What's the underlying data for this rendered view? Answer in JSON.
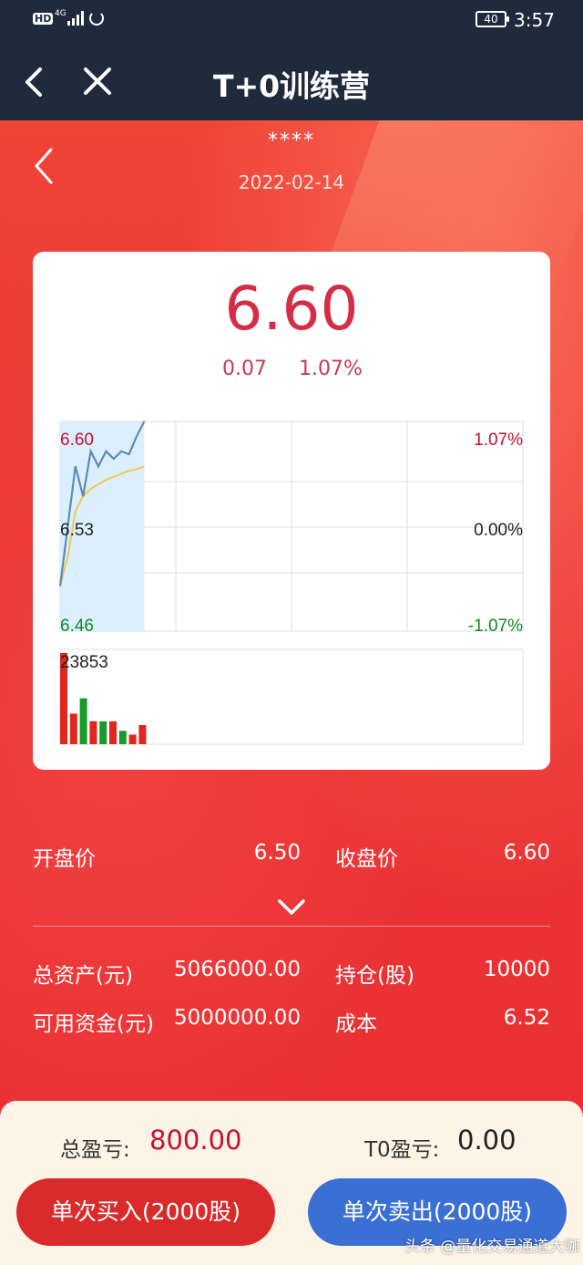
{
  "status_bar": {
    "hd": "HD",
    "network": "4G",
    "battery": "40",
    "time": "3:57"
  },
  "nav": {
    "title": "T+0训练营"
  },
  "stock": {
    "name": "****",
    "date": "2022-02-14",
    "price": "6.60",
    "change": "0.07",
    "change_pct": "1.07%"
  },
  "chart_data": {
    "type": "line",
    "price_axis": {
      "high": "6.60",
      "mid": "6.53",
      "low": "6.46"
    },
    "pct_axis": {
      "high": "1.07%",
      "mid": "0.00%",
      "low": "-1.07%"
    },
    "ylim": [
      6.46,
      6.6
    ],
    "grid": true,
    "series": [
      {
        "values": [
          6.49,
          6.53,
          6.57,
          6.55,
          6.58,
          6.57,
          6.58,
          6.575,
          6.58,
          6.578,
          6.59,
          6.6
        ],
        "color": "#5b8ab8"
      },
      {
        "values": [
          6.49,
          6.51,
          6.54,
          6.55,
          6.555,
          6.558,
          6.561,
          6.563,
          6.565,
          6.567,
          6.568,
          6.57
        ],
        "color": "#f0c94b"
      }
    ],
    "volume": {
      "max_label": "23853",
      "bars": [
        {
          "value": 23853,
          "color": "#e0261e"
        },
        {
          "value": 8000,
          "color": "#e0261e"
        },
        {
          "value": 12000,
          "color": "#1a9a2a"
        },
        {
          "value": 6000,
          "color": "#e0261e"
        },
        {
          "value": 6000,
          "color": "#1a9a2a"
        },
        {
          "value": 6000,
          "color": "#e0261e"
        },
        {
          "value": 3500,
          "color": "#1a9a2a"
        },
        {
          "value": 2500,
          "color": "#e0261e"
        },
        {
          "value": 5000,
          "color": "#e0261e"
        }
      ]
    },
    "colors": {
      "up": "#c8102e",
      "flat": "#222222",
      "down": "#0f8a1f",
      "area": "#dcefff"
    }
  },
  "info": {
    "open_label": "开盘价",
    "open_value": "6.50",
    "close_label": "收盘价",
    "close_value": "6.60",
    "total_assets_label": "总资产(元)",
    "total_assets_value": "5066000.00",
    "position_label": "持仓(股)",
    "position_value": "10000",
    "available_label": "可用资金(元)",
    "available_value": "5000000.00",
    "cost_label": "成本",
    "cost_value": "6.52"
  },
  "bottom": {
    "total_pl_label": "总盈亏:",
    "total_pl_value": "800.00",
    "t0_pl_label": "T0盈亏:",
    "t0_pl_value": "0.00",
    "buy_label": "单次买入(2000股)",
    "sell_label": "单次卖出(2000股)",
    "watermark": "头条 @量化交易通道大咖"
  }
}
